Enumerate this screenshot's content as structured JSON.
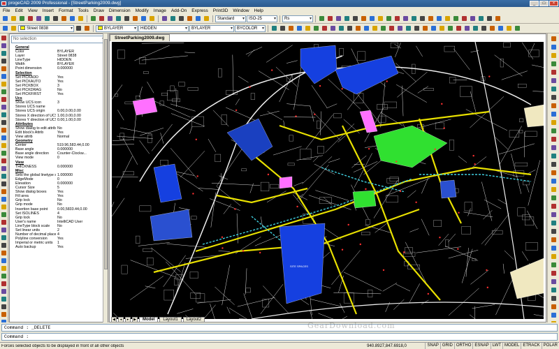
{
  "window": {
    "title": "progeCAD 2009 Professional - [StreetParking2009.dwg]"
  },
  "menu": [
    "File",
    "Edit",
    "View",
    "Insert",
    "Format",
    "Tools",
    "Draw",
    "Dimension",
    "Modify",
    "Image",
    "Add-On",
    "Express",
    "Print3D",
    "Window",
    "Help"
  ],
  "toolbar1": {
    "text_style": "Standard",
    "dim_style": "ISO-25",
    "scale": "Rs"
  },
  "toolbar2": {
    "layer": "Street 0838",
    "color": "BYLAYER",
    "linetype": "HIDDEN",
    "lineweight": "BYLAYER",
    "plotstyle": "BYCOLOR"
  },
  "colors": {
    "layer_swatch": "#f0f000",
    "color_swatch": "#f0f000"
  },
  "properties": {
    "filter": "No selection",
    "rows": [
      {
        "section": true,
        "key": "General"
      },
      {
        "key": "Color",
        "value": "BYLAYER"
      },
      {
        "key": "Layer",
        "value": "Street 0838"
      },
      {
        "key": "LineType",
        "value": "HIDDEN"
      },
      {
        "key": "Width",
        "value": "BYLAYER"
      },
      {
        "key": "Point dimension",
        "value": "0.000000"
      },
      {
        "section": true,
        "key": "Selection"
      },
      {
        "key": "Set PICKADD",
        "value": "Yes"
      },
      {
        "key": "Set PICKAUTO",
        "value": "Yes"
      },
      {
        "key": "Set PICKBOX",
        "value": "3"
      },
      {
        "key": "Set PICKDRAG",
        "value": "No"
      },
      {
        "key": "Set PICKFIRST",
        "value": "Yes"
      },
      {
        "section": true,
        "key": "Ucs"
      },
      {
        "key": "Show UCS icon",
        "value": "3"
      },
      {
        "key": "Stores UCS name",
        "value": ""
      },
      {
        "key": "Stores UCS origin",
        "value": "0.00,0.00,0.00"
      },
      {
        "key": "Stores X direction of UCS",
        "value": "1.00,0.00,0.00"
      },
      {
        "key": "Stores Y direction of UCS",
        "value": "0.00,1.00,0.00"
      },
      {
        "section": true,
        "key": "Attributes"
      },
      {
        "key": "Show dialog to edit attrib",
        "value": "No"
      },
      {
        "key": "Edit block's Attrib",
        "value": "Yes"
      },
      {
        "key": "View attrib",
        "value": "Normal"
      },
      {
        "section": true,
        "key": "Geometry"
      },
      {
        "key": "Center",
        "value": "519.96,583.44,0.00"
      },
      {
        "key": "Base angle",
        "value": "0.000000"
      },
      {
        "key": "Base angle direction",
        "value": "Counter-Clockw..."
      },
      {
        "key": "View mode",
        "value": "0"
      },
      {
        "section": true,
        "key": "View"
      },
      {
        "key": "THICKNESS",
        "value": "0.000000"
      },
      {
        "section": true,
        "key": "Misc"
      },
      {
        "key": "Sets the global linetype s...",
        "value": "1.000000"
      },
      {
        "key": "EdgeMode",
        "value": "0"
      },
      {
        "key": "Elevation",
        "value": "0.000000"
      },
      {
        "key": "Cursor Size",
        "value": "5"
      },
      {
        "key": "Show dialog boxes",
        "value": "Yes"
      },
      {
        "key": "Fill area",
        "value": "Yes"
      },
      {
        "key": "Grip lock",
        "value": "No"
      },
      {
        "key": "Grip mode",
        "value": "No"
      },
      {
        "key": "Insertion base point",
        "value": "0.00,5833.44,0.00"
      },
      {
        "key": "Set ISOLINES",
        "value": "4"
      },
      {
        "key": "Grip lock",
        "value": "No"
      },
      {
        "key": "User's name",
        "value": "IntelliCAD User"
      },
      {
        "key": "LineType block scale",
        "value": "No"
      },
      {
        "key": "Set linear units",
        "value": "2"
      },
      {
        "key": "Number of decimal places",
        "value": "4"
      },
      {
        "key": "Polyline conversion",
        "value": "Yes"
      },
      {
        "key": "Imperial or metric units",
        "value": "1"
      },
      {
        "key": "Auto backup",
        "value": "Yes"
      }
    ]
  },
  "drawing": {
    "tab": "StreetParking2009.dwg",
    "layout_tabs": [
      "Model",
      "Layout1",
      "Layout2"
    ],
    "labels": {
      "lot": "SITE SPACES"
    }
  },
  "command": {
    "history": "Command :  _DELETE",
    "prompt": "Command :"
  },
  "status": {
    "message": "Forces selected objects to be displayed in front of all other objects",
    "coords": "940.8927,847.6918,0",
    "modes": [
      "SNAP",
      "GRID",
      "ORTHO",
      "ESNAP",
      "LWT",
      "MODEL",
      "ETRACK",
      "POLAR"
    ]
  },
  "watermark": "GearDownload.com"
}
